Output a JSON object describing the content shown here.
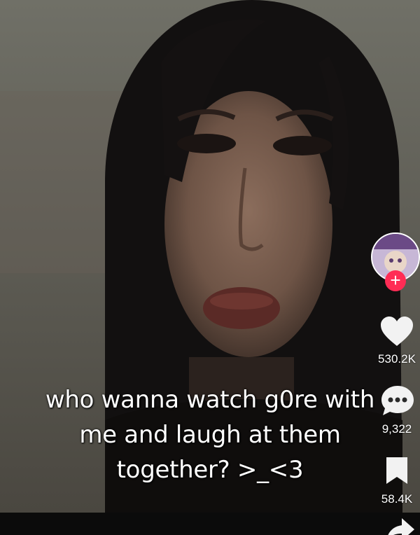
{
  "caption": {
    "lines": [
      "who wanna watch g0re with",
      "me and laugh at them",
      "together? >_<3"
    ]
  },
  "actions": {
    "follow_plus": "+",
    "likes": "530.2K",
    "comments": "9,322",
    "bookmarks": "58.4K"
  },
  "icons": {
    "like": "heart-icon",
    "comment": "comment-bubble-icon",
    "bookmark": "bookmark-icon",
    "share": "share-arrow-icon"
  },
  "colors": {
    "follow_accent": "#ff2c55",
    "text": "#ffffff"
  }
}
